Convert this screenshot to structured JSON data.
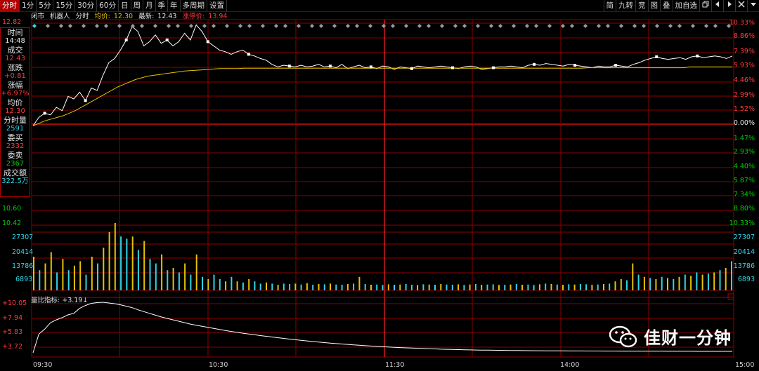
{
  "toolbar": {
    "tabs": [
      "分时",
      "1分",
      "5分",
      "15分",
      "30分",
      "60分",
      "日",
      "周",
      "月",
      "季",
      "年",
      "多周期",
      "设置"
    ],
    "right_tools": [
      "简",
      "九转",
      "竞",
      "图",
      "叠",
      "加自选"
    ],
    "window_controls": [
      "restore-icon",
      "arrow-left-icon",
      "arrow-right-icon",
      "close-icon",
      "dropdown-icon"
    ]
  },
  "info": {
    "status": "闭市",
    "name": "机器人",
    "timeshare": "分时",
    "avg_label": "均价:",
    "avg_value": "12.30",
    "latest_label": "最新:",
    "latest_value": "12.43",
    "limit_label": "涨停价:",
    "limit_value": "13.94"
  },
  "panel": {
    "time_label": "时间",
    "time_value": "14:48",
    "deal_label": "成交",
    "deal_value": "12.43",
    "change_label": "涨跌",
    "change_value": "+0.81",
    "pct_label": "涨幅",
    "pct_value": "+6.97%",
    "avg_label": "均价",
    "avg_value": "12.30",
    "vol_label": "分时量",
    "vol_value": "2591",
    "buy_label": "委买",
    "buy_value": "2332",
    "sell_label": "委卖",
    "sell_value": "2367",
    "amount_label": "成交额",
    "amount_value": "322.5万"
  },
  "price_axis": {
    "left_labels": [
      "12.82",
      "10.60",
      "10.42"
    ],
    "right_up": [
      "10.33%",
      "8.86%",
      "7.39%",
      "5.93%",
      "4.46%",
      "2.99%",
      "1.52%"
    ],
    "right_zero": "0.00%",
    "right_down": [
      "1.47%",
      "2.93%",
      "4.40%",
      "5.87%",
      "7.34%",
      "8.80%",
      "10.33%"
    ]
  },
  "volume_axis": {
    "labels": [
      "27307",
      "20414",
      "13786",
      "6893"
    ]
  },
  "lb_axis": {
    "labels": [
      "+10.05",
      "+7.94",
      "+5.83",
      "+3.72"
    ],
    "indicator_label": "量比指标:",
    "indicator_value": "+3.19"
  },
  "time_axis": [
    "09:30",
    "10:30",
    "11:30",
    "14:00",
    "15:00"
  ],
  "colors": {
    "grid": "#8b0000",
    "price_line": "#ffffff",
    "avg_line": "#e6c200",
    "up_bar": "#e6c200",
    "down_bar": "#2ed6e6",
    "lb_line": "#ffffff",
    "selected_line": "#ff0000"
  },
  "watermark": {
    "text": "佳财一分钟",
    "icon": "wechat-icon"
  },
  "chart_data": {
    "type": "line",
    "price": {
      "prev_close": 11.62,
      "ylim": [
        10.42,
        12.82
      ],
      "series": [
        {
          "name": "分时",
          "values": [
            11.6,
            11.7,
            11.75,
            11.73,
            11.82,
            11.78,
            11.95,
            11.92,
            12.0,
            11.9,
            12.05,
            12.02,
            12.2,
            12.35,
            12.4,
            12.5,
            12.62,
            12.78,
            12.72,
            12.55,
            12.6,
            12.68,
            12.58,
            12.62,
            12.55,
            12.6,
            12.7,
            12.62,
            12.8,
            12.72,
            12.6,
            12.55,
            12.5,
            12.48,
            12.45,
            12.48,
            12.5,
            12.45,
            12.43,
            12.4,
            12.38,
            12.33,
            12.3,
            12.32,
            12.31,
            12.3,
            12.32,
            12.3,
            12.31,
            12.33,
            12.3,
            12.31,
            12.29,
            12.33,
            12.28,
            12.3,
            12.32,
            12.29,
            12.3,
            12.28,
            12.31,
            12.3,
            12.27,
            12.3,
            12.29,
            12.28,
            12.31,
            12.3,
            12.29,
            12.3,
            12.31,
            12.3,
            12.29,
            12.28,
            12.3,
            12.31,
            12.3,
            12.27,
            12.28,
            12.29,
            12.3,
            12.3,
            12.31,
            12.3,
            12.29,
            12.32,
            12.33,
            12.32,
            12.34,
            12.33,
            12.32,
            12.31,
            12.33,
            12.32,
            12.31,
            12.3,
            12.29,
            12.31,
            12.3,
            12.3,
            12.32,
            12.31,
            12.3,
            12.33,
            12.35,
            12.38,
            12.4,
            12.42,
            12.4,
            12.39,
            12.4,
            12.41,
            12.39,
            12.42,
            12.43,
            12.41,
            12.42,
            12.43,
            12.42,
            12.4,
            12.43
          ]
        },
        {
          "name": "均价",
          "values": [
            11.6,
            11.63,
            11.66,
            11.68,
            11.7,
            11.72,
            11.75,
            11.78,
            11.82,
            11.86,
            11.9,
            11.94,
            11.98,
            12.02,
            12.06,
            12.09,
            12.12,
            12.15,
            12.17,
            12.19,
            12.2,
            12.21,
            12.22,
            12.23,
            12.24,
            12.25,
            12.255,
            12.26,
            12.265,
            12.27,
            12.275,
            12.28,
            12.28,
            12.28,
            12.28,
            12.285,
            12.285,
            12.285,
            12.285,
            12.285,
            12.285,
            12.285,
            12.285,
            12.285,
            12.285,
            12.285,
            12.285,
            12.285,
            12.285,
            12.285,
            12.285,
            12.285,
            12.285,
            12.285,
            12.285,
            12.285,
            12.285,
            12.285,
            12.285,
            12.285,
            12.285,
            12.285,
            12.285,
            12.285,
            12.285,
            12.285,
            12.285,
            12.285,
            12.285,
            12.285,
            12.285,
            12.285,
            12.285,
            12.285,
            12.285,
            12.285,
            12.285,
            12.285,
            12.285,
            12.285,
            12.285,
            12.285,
            12.285,
            12.285,
            12.285,
            12.285,
            12.285,
            12.285,
            12.285,
            12.285,
            12.285,
            12.285,
            12.29,
            12.29,
            12.29,
            12.29,
            12.29,
            12.29,
            12.29,
            12.29,
            12.29,
            12.29,
            12.29,
            12.29,
            12.29,
            12.29,
            12.29,
            12.29,
            12.29,
            12.3,
            12.3,
            12.3,
            12.3,
            12.3,
            12.3,
            12.3,
            12.3
          ]
        }
      ]
    },
    "volume": {
      "ylim": [
        0,
        30000
      ],
      "values": [
        15000,
        9000,
        12000,
        17000,
        8000,
        14000,
        9000,
        11000,
        13000,
        7000,
        15000,
        12000,
        19000,
        26000,
        30000,
        24000,
        23000,
        24000,
        18000,
        22000,
        14000,
        12000,
        16000,
        9000,
        10000,
        8000,
        12000,
        7000,
        16000,
        6000,
        5000,
        7000,
        5000,
        4000,
        6000,
        4000,
        3500,
        5000,
        4000,
        3000,
        3500,
        3000,
        2500,
        3000,
        2800,
        3000,
        2600,
        3200,
        2500,
        2800,
        2700,
        3000,
        2600,
        2500,
        2800,
        3000,
        6000,
        2800,
        2500,
        2600,
        2400,
        2700,
        2500,
        2600,
        2800,
        2500,
        2400,
        2700,
        2600,
        2500,
        2800,
        2600,
        2500,
        2700,
        2400,
        2600,
        2800,
        2500,
        2600,
        2700,
        2400,
        2500,
        2600,
        2800,
        2500,
        2600,
        2400,
        2700,
        3000,
        2800,
        2600,
        2500,
        2700,
        2600,
        2800,
        2700,
        2500,
        2600,
        2800,
        3000,
        4000,
        5000,
        4500,
        12000,
        7000,
        6000,
        5500,
        5000,
        6000,
        5500,
        5000,
        6000,
        7000,
        6500,
        8000,
        7000,
        7500,
        8000,
        9000,
        10000,
        13000
      ],
      "up_flags": [
        1,
        0,
        1,
        1,
        0,
        1,
        0,
        1,
        1,
        0,
        1,
        0,
        1,
        1,
        1,
        0,
        0,
        1,
        0,
        1,
        0,
        0,
        1,
        0,
        1,
        0,
        1,
        0,
        1,
        0,
        1,
        0,
        0,
        1,
        0,
        1,
        0,
        1,
        0,
        0,
        1,
        0,
        1,
        0,
        0,
        1,
        0,
        1,
        0,
        1,
        0,
        1,
        0,
        0,
        1,
        0,
        1,
        0,
        1,
        0,
        0,
        1,
        0,
        1,
        0,
        0,
        1,
        0,
        1,
        0,
        1,
        0,
        0,
        1,
        0,
        1,
        0,
        1,
        0,
        0,
        1,
        0,
        1,
        0,
        1,
        0,
        0,
        1,
        0,
        1,
        0,
        1,
        0,
        1,
        0,
        0,
        1,
        0,
        1,
        0,
        1,
        1,
        0,
        1,
        0,
        1,
        0,
        1,
        0,
        1,
        0,
        1,
        0,
        1,
        0,
        1,
        0,
        1,
        0,
        1,
        0
      ]
    },
    "lb": {
      "ylim": [
        2.8,
        10.05
      ],
      "values": [
        3.0,
        5.6,
        6.3,
        7.2,
        7.6,
        7.9,
        8.3,
        8.5,
        9.2,
        9.6,
        9.9,
        10.0,
        10.05,
        9.95,
        9.85,
        9.7,
        9.5,
        9.3,
        9.0,
        8.75,
        8.5,
        8.25,
        8.0,
        7.8,
        7.6,
        7.4,
        7.2,
        7.0,
        6.85,
        6.7,
        6.55,
        6.4,
        6.25,
        6.1,
        5.97,
        5.85,
        5.73,
        5.62,
        5.51,
        5.4,
        5.3,
        5.2,
        5.1,
        5.0,
        4.91,
        4.82,
        4.73,
        4.65,
        4.57,
        4.49,
        4.42,
        4.35,
        4.28,
        4.22,
        4.16,
        4.1,
        4.04,
        3.99,
        3.94,
        3.89,
        3.84,
        3.8,
        3.76,
        3.72,
        3.68,
        3.65,
        3.62,
        3.59,
        3.56,
        3.53,
        3.5,
        3.48,
        3.46,
        3.44,
        3.42,
        3.4,
        3.38,
        3.37,
        3.36,
        3.35,
        3.34,
        3.33,
        3.32,
        3.31,
        3.3,
        3.29,
        3.28,
        3.28,
        3.27,
        3.27,
        3.26,
        3.26,
        3.25,
        3.25,
        3.25,
        3.24,
        3.24,
        3.24,
        3.23,
        3.23,
        3.23,
        3.22,
        3.22,
        3.22,
        3.22,
        3.21,
        3.21,
        3.21,
        3.21,
        3.2,
        3.2,
        3.2,
        3.2,
        3.2,
        3.19,
        3.19,
        3.19,
        3.19,
        3.19,
        3.19,
        3.19
      ]
    },
    "sessions": [
      "09:30",
      "10:30",
      "11:30",
      "14:00",
      "15:00"
    ]
  }
}
